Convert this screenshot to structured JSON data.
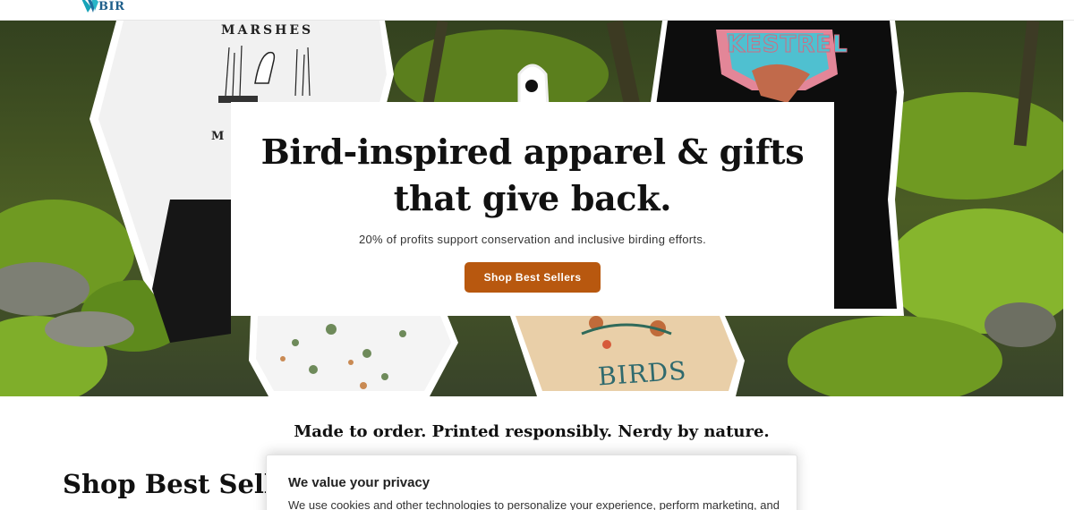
{
  "header": {
    "logo_text": "BIR",
    "logo_icon": "bird-wing-logo"
  },
  "hero": {
    "title_line1": "Bird-inspired apparel & gifts",
    "title_line2": "that give back.",
    "subtitle": "20% of profits support conservation and inclusive birding efforts.",
    "cta_label": "Shop Best Sellers",
    "product_texts": {
      "sweatshirt_top": "MARSHES",
      "sweatshirt_letter": "M",
      "hoodie": "KESTREL",
      "tote": "BIRDS"
    },
    "colors": {
      "cta": "#b8580f",
      "moss": "#4f7a1e"
    }
  },
  "tagline": "Made to order. Printed responsibly. Nerdy by nature.",
  "best_sellers": {
    "title": "Shop Best Sellers"
  },
  "cookie_banner": {
    "title": "We value your privacy",
    "text": "We use cookies and other technologies to personalize your experience, perform marketing, and"
  }
}
